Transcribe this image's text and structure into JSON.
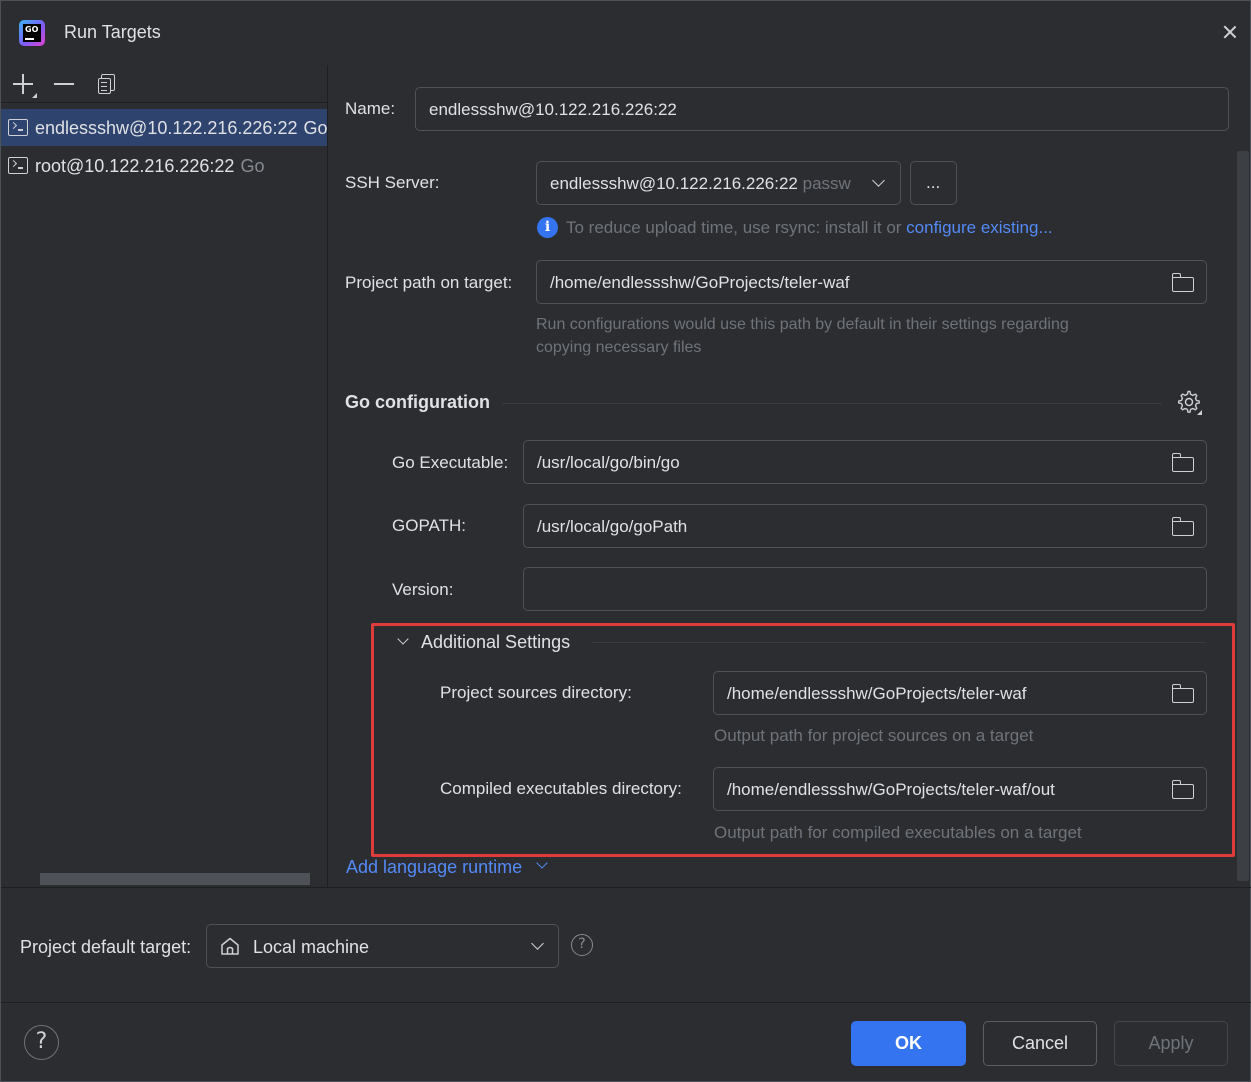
{
  "window": {
    "title": "Run Targets",
    "app_icon_text": "GO"
  },
  "left": {
    "targets": [
      {
        "label": "endlessshw@10.122.216.226:22",
        "type": "Go",
        "selected": true
      },
      {
        "label": "root@10.122.216.226:22",
        "type": "Go",
        "selected": false
      }
    ]
  },
  "form": {
    "name_label": "Name:",
    "name_value": "endlessshw@10.122.216.226:22",
    "ssh_label": "SSH Server:",
    "ssh_value": "endlessshw@10.122.216.226:22",
    "ssh_auth": "passw",
    "ssh_more": "...",
    "rsync_hint": "To reduce upload time, use rsync: install it or ",
    "rsync_link": "configure existing...",
    "project_path_label": "Project path on target:",
    "project_path_value": "/home/endlessshw/GoProjects/teler-waf",
    "project_path_hint_1": "Run configurations would use this path by default in their settings regarding",
    "project_path_hint_2": "copying necessary files",
    "go_section_title": "Go configuration",
    "go_exec_label": "Go Executable:",
    "go_exec_value": "/usr/local/go/bin/go",
    "gopath_label": "GOPATH:",
    "gopath_value": "/usr/local/go/goPath",
    "version_label": "Version:",
    "version_value": "",
    "additional_title": "Additional Settings",
    "sources_label": "Project sources directory:",
    "sources_value": "/home/endlessshw/GoProjects/teler-waf",
    "sources_hint": "Output path for project sources on a target",
    "compiled_label": "Compiled executables directory:",
    "compiled_value": "/home/endlessshw/GoProjects/teler-waf/out",
    "compiled_hint": "Output path for compiled executables on a target",
    "add_runtime": "Add language runtime"
  },
  "bottom": {
    "default_target_label": "Project default target:",
    "default_target_value": "Local machine",
    "help_glyph": "?",
    "ok": "OK",
    "cancel": "Cancel",
    "apply": "Apply"
  },
  "colors": {
    "accent": "#3574f0",
    "link": "#548af7",
    "highlight_box": "#e03b3b",
    "background": "#2b2d30"
  }
}
